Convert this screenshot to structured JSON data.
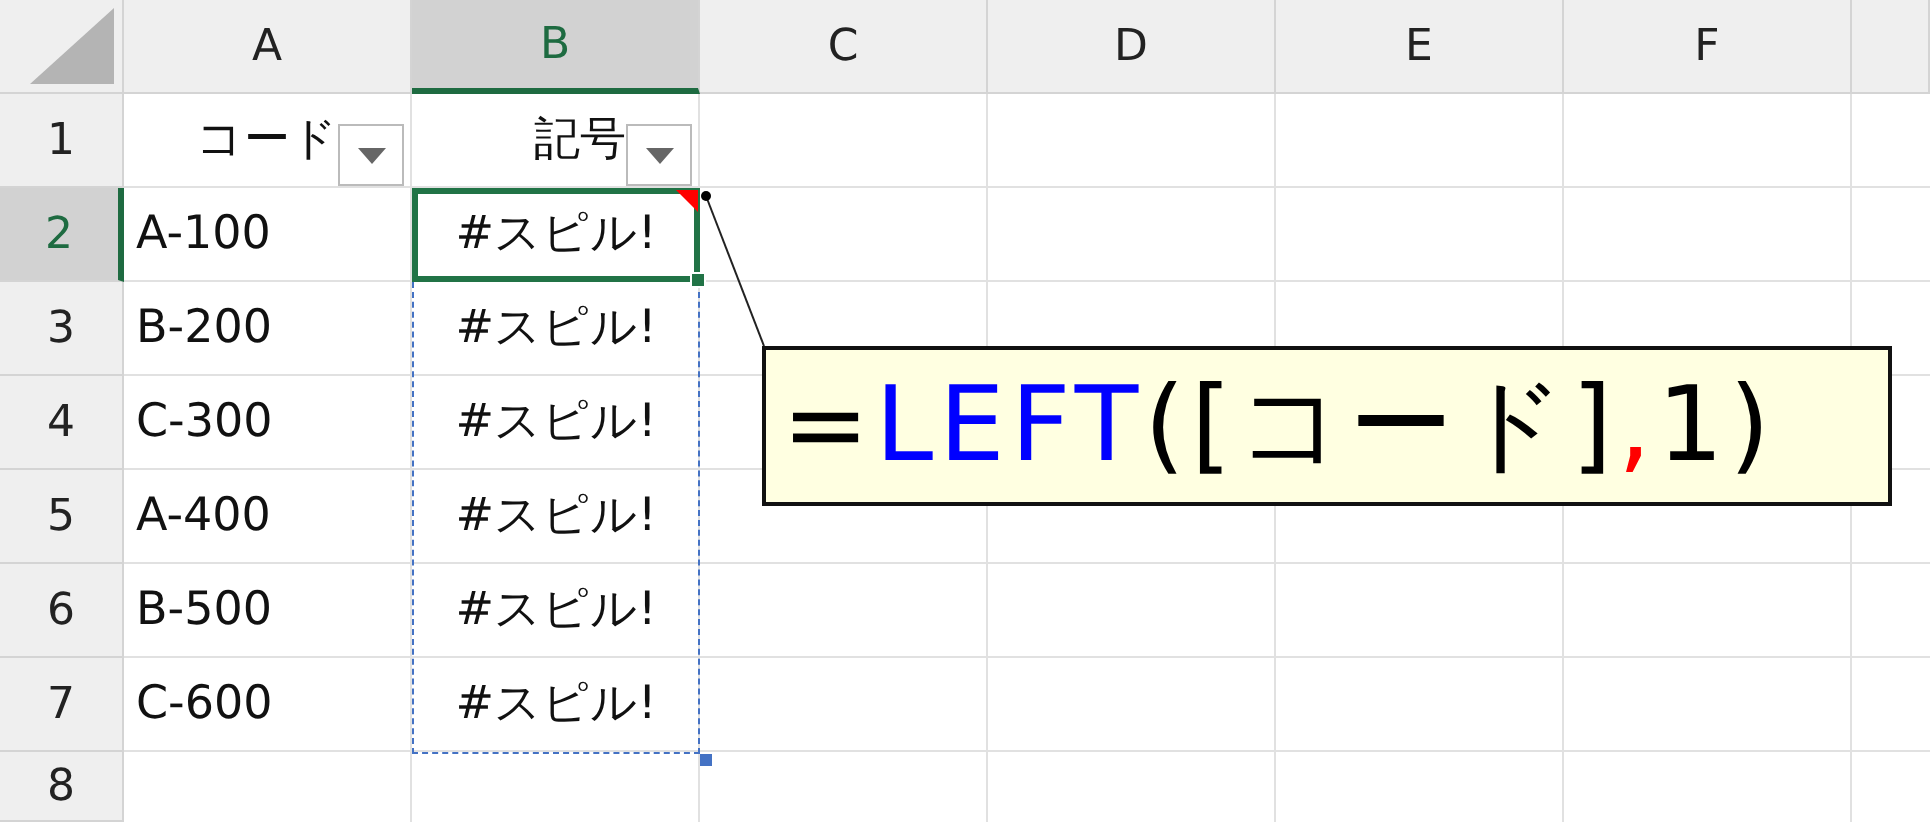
{
  "columns": [
    {
      "label": "A",
      "selected": false
    },
    {
      "label": "B",
      "selected": true
    },
    {
      "label": "C",
      "selected": false
    },
    {
      "label": "D",
      "selected": false
    },
    {
      "label": "E",
      "selected": false
    },
    {
      "label": "F",
      "selected": false
    }
  ],
  "row_headers": [
    {
      "label": "1",
      "selected": false
    },
    {
      "label": "2",
      "selected": true
    },
    {
      "label": "3",
      "selected": false
    },
    {
      "label": "4",
      "selected": false
    },
    {
      "label": "5",
      "selected": false
    },
    {
      "label": "6",
      "selected": false
    },
    {
      "label": "7",
      "selected": false
    },
    {
      "label": "8",
      "selected": false
    }
  ],
  "table": {
    "headers": [
      {
        "text": "コード",
        "filter": true
      },
      {
        "text": "記号",
        "filter": true
      }
    ],
    "spill_outline": true,
    "rows": [
      {
        "code": "A-100",
        "symbol": {
          "text": "#スピル!",
          "selected": true,
          "error_flag": true
        }
      },
      {
        "code": "B-200",
        "symbol": {
          "text": "#スピル!",
          "selected": false,
          "error_flag": false
        }
      },
      {
        "code": "C-300",
        "symbol": {
          "text": "#スピル!",
          "selected": false,
          "error_flag": false
        }
      },
      {
        "code": "A-400",
        "symbol": {
          "text": "#スピル!",
          "selected": false,
          "error_flag": false
        }
      },
      {
        "code": "B-500",
        "symbol": {
          "text": "#スピル!",
          "selected": false,
          "error_flag": false
        }
      },
      {
        "code": "C-600",
        "symbol": {
          "text": "#スピル!",
          "selected": false,
          "error_flag": false
        }
      }
    ]
  },
  "callout": {
    "segments": [
      {
        "text": "=",
        "color": "#000000"
      },
      {
        "text": "LEFT",
        "color": "#0000ff"
      },
      {
        "text": "([コード]",
        "color": "#000000"
      },
      {
        "text": ",",
        "color": "#ff0000"
      },
      {
        "text": " 1)",
        "color": "#000000"
      }
    ]
  }
}
